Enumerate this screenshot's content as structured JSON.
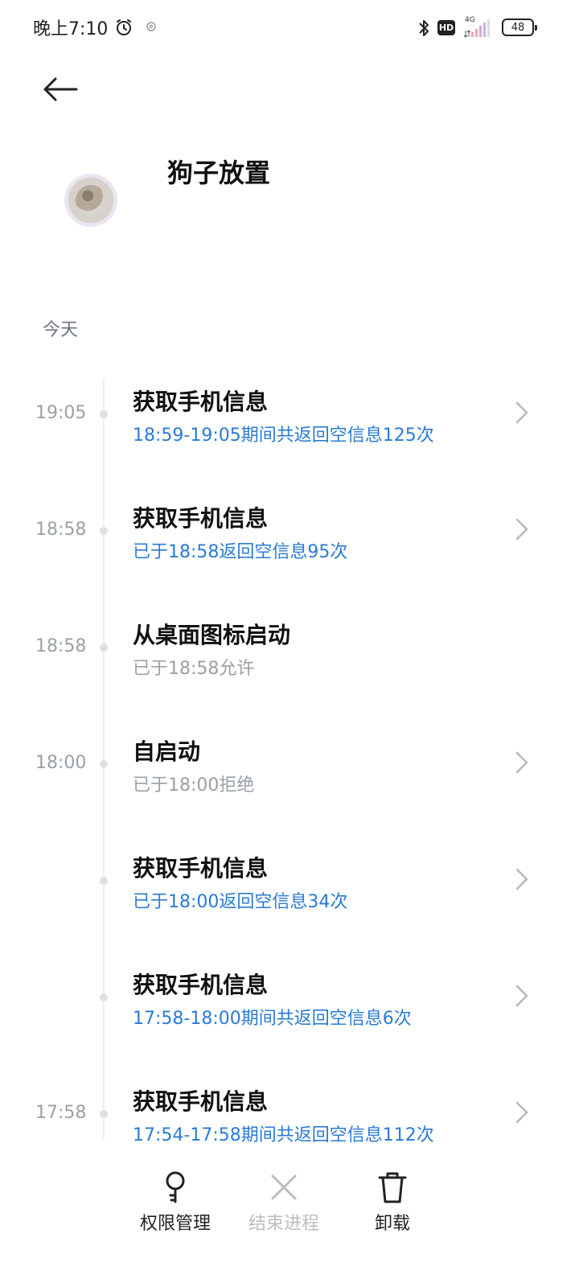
{
  "status_bar": {
    "time": "晚上7:10",
    "network": "4G",
    "hd": "HD",
    "battery": "48"
  },
  "header": {
    "title": "狗子放置"
  },
  "section": {
    "label": "今天"
  },
  "colors": {
    "link_blue": "#2a7bd5",
    "muted_gray": "#9aa0a6",
    "title_black": "#111111"
  },
  "timeline": [
    {
      "time": "19:05",
      "title": "获取手机信息",
      "subtitle": "18:59-19:05期间共返回空信息125次",
      "accent": "blue",
      "chevron": true
    },
    {
      "time": "18:58",
      "title": "获取手机信息",
      "subtitle": "已于18:58返回空信息95次",
      "accent": "blue",
      "chevron": true
    },
    {
      "time": "18:58",
      "title": "从桌面图标启动",
      "subtitle": "已于18:58允许",
      "accent": "gray",
      "chevron": false
    },
    {
      "time": "18:00",
      "title": "自启动",
      "subtitle": "已于18:00拒绝",
      "accent": "gray",
      "chevron": true
    },
    {
      "time": "",
      "title": "获取手机信息",
      "subtitle": "已于18:00返回空信息34次",
      "accent": "blue",
      "chevron": true
    },
    {
      "time": "",
      "title": "获取手机信息",
      "subtitle": "17:58-18:00期间共返回空信息6次",
      "accent": "blue",
      "chevron": true
    },
    {
      "time": "17:58",
      "title": "获取手机信息",
      "subtitle": "17:54-17:58期间共返回空信息112次",
      "accent": "blue",
      "chevron": true
    }
  ],
  "bottom_bar": {
    "permissions": {
      "label": "权限管理",
      "icon": "key-icon"
    },
    "end_process": {
      "label": "结束进程",
      "icon": "close-icon",
      "disabled": true
    },
    "uninstall": {
      "label": "卸载",
      "icon": "trash-icon"
    }
  }
}
